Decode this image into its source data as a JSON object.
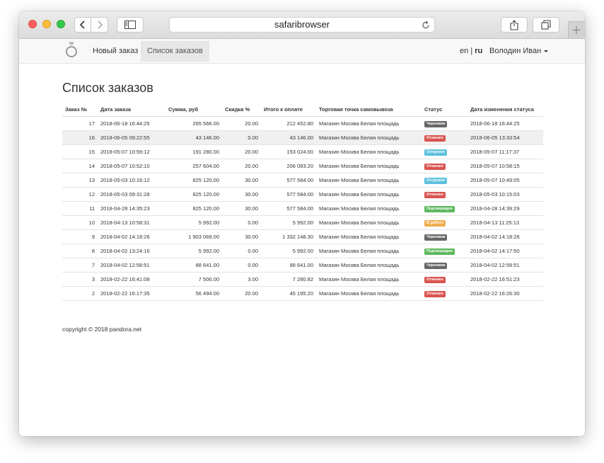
{
  "browser": {
    "address": "safaribrowser"
  },
  "nav": {
    "new_order": "Новый заказ",
    "orders_list": "Список заказов",
    "lang_en": "en",
    "lang_sep": "|",
    "lang_ru": "ru",
    "user": "Володин Иван"
  },
  "page": {
    "title": "Список заказов"
  },
  "table": {
    "headers": [
      "Заказ №",
      "Дата заказа",
      "Сумма, руб",
      "Скидка %",
      "Итого к оплате",
      "Торговая точка самовывоза",
      "Статус",
      "Дата изменения статуса"
    ],
    "rows": [
      {
        "id": "17",
        "date": "2018-06-18 16:44:25",
        "sum": "265 566.00",
        "discount": "20.00",
        "total": "212 452.80",
        "store": "Магазин Москва Белая площадь",
        "status": "Черновик",
        "status_color": "#666666",
        "changed": "2018-06-18 16:44:25"
      },
      {
        "id": "16",
        "date": "2018-06-05 09:22:55",
        "sum": "43 146.00",
        "discount": "0.00",
        "total": "43 146.00",
        "store": "Магазин Москва Белая площадь",
        "status": "Отменен",
        "status_color": "#d9534f",
        "changed": "2018-06-05 13:33:54"
      },
      {
        "id": "15",
        "date": "2018-05-07 10:59:12",
        "sum": "191 280.00",
        "discount": "20.00",
        "total": "153 024.00",
        "store": "Магазин Москва Белая площадь",
        "status": "Отгружен",
        "status_color": "#5bc0de",
        "changed": "2018-05-07 11:17:37"
      },
      {
        "id": "14",
        "date": "2018-05-07 10:52:10",
        "sum": "257 604.00",
        "discount": "20.00",
        "total": "206 083.20",
        "store": "Магазин Москва Белая площадь",
        "status": "Отменен",
        "status_color": "#d9534f",
        "changed": "2018-05-07 10:58:15"
      },
      {
        "id": "13",
        "date": "2018-05-03 10:16:12",
        "sum": "825 120.00",
        "discount": "30.00",
        "total": "577 584.00",
        "store": "Магазин Москва Белая площадь",
        "status": "Отгружен",
        "status_color": "#5bc0de",
        "changed": "2018-05-07 10:49:05"
      },
      {
        "id": "12",
        "date": "2018-05-03 09:31:28",
        "sum": "825 120.00",
        "discount": "30.00",
        "total": "577 584.00",
        "store": "Магазин Москва Белая площадь",
        "status": "Отменен",
        "status_color": "#d9534f",
        "changed": "2018-05-03 10:15:03"
      },
      {
        "id": "11",
        "date": "2018-04-28 14:35:23",
        "sum": "825 120.00",
        "discount": "30.00",
        "total": "577 584.00",
        "store": "Магазин Москва Белая площадь",
        "status": "Подтвержден",
        "status_color": "#5cb85c",
        "changed": "2018-04-28 14:39:29"
      },
      {
        "id": "10",
        "date": "2018-04-13 10:58:31",
        "sum": "5 992.00",
        "discount": "0.00",
        "total": "5 992.00",
        "store": "Магазин Москва Белая площадь",
        "status": "В работе",
        "status_color": "#f0ad4e",
        "changed": "2018-04-13 11:25:13"
      },
      {
        "id": "9",
        "date": "2018-04-02 14:18:26",
        "sum": "1 903 069.00",
        "discount": "30.00",
        "total": "1 332 148.30",
        "store": "Магазин Москва Белая площадь",
        "status": "Черновик",
        "status_color": "#666666",
        "changed": "2018-04-02 14:18:26"
      },
      {
        "id": "8",
        "date": "2018-04-02 13:24:16",
        "sum": "5 992.00",
        "discount": "0.00",
        "total": "5 992.00",
        "store": "Магазин Москва Белая площадь",
        "status": "Подтвержден",
        "status_color": "#5cb85c",
        "changed": "2018-04-02 14:17:50"
      },
      {
        "id": "7",
        "date": "2018-04-02 12:58:51",
        "sum": "88 641.00",
        "discount": "0.00",
        "total": "88 641.00",
        "store": "Магазин Москва Белая площадь",
        "status": "Черновик",
        "status_color": "#666666",
        "changed": "2018-04-02 12:58:51"
      },
      {
        "id": "3",
        "date": "2018-02-22 16:41:08",
        "sum": "7 506.00",
        "discount": "3.00",
        "total": "7 280.82",
        "store": "Магазин Москва Белая площадь",
        "status": "Отменен",
        "status_color": "#d9534f",
        "changed": "2018-02-22 16:51:23"
      },
      {
        "id": "2",
        "date": "2018-02-22 16:17:35",
        "sum": "56 494.00",
        "discount": "20.00",
        "total": "45 195.20",
        "store": "Магазин Москва Белая площадь",
        "status": "Отменен",
        "status_color": "#d9534f",
        "changed": "2018-02-22 16:26:30"
      }
    ]
  },
  "footer": {
    "text": "copyright © 2018 pandora.net"
  }
}
